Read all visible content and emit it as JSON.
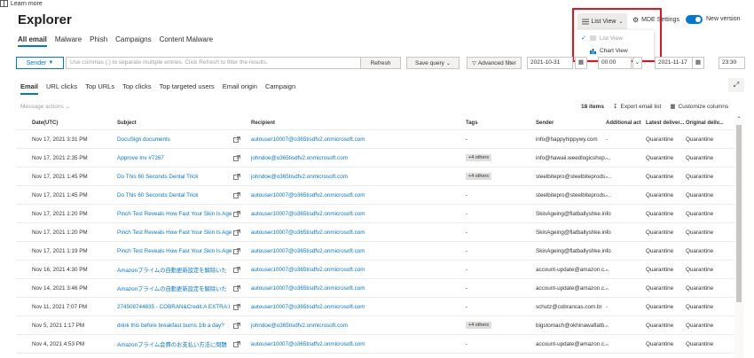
{
  "page": {
    "title": "Explorer"
  },
  "top": {
    "learn_more": "Learn more",
    "list_view": "List View",
    "mde_settings": "MDE Settings",
    "new_version": "New version"
  },
  "dropdown": {
    "list_view": "List View",
    "chart_view": "Chart View"
  },
  "tabs_top": [
    "All email",
    "Malware",
    "Phish",
    "Campaigns",
    "Content Malware"
  ],
  "filter": {
    "sender_label": "Sender",
    "placeholder": "Use commas (,) to separate multiple entries. Click Refresh to filter the results.",
    "refresh": "Refresh",
    "save_query": "Save query",
    "advanced_filter": "Advanced filter",
    "start_date": "2021-10-31",
    "start_time": "00:00",
    "end_date": "2021-11-17",
    "end_time": "23:30"
  },
  "tabs_sub": [
    "Email",
    "URL clicks",
    "Top URLs",
    "Top clicks",
    "Top targeted users",
    "Email origin",
    "Campaign"
  ],
  "message_actions": "Message actions",
  "items_count": "18 items",
  "export": "Export email list",
  "customize": "Customize columns",
  "table": {
    "headers": {
      "date": "Date(UTC)",
      "subject": "Subject",
      "recipient": "Recipient",
      "tags": "Tags",
      "sender": "Sender",
      "additional": "Additional act...",
      "latest": "Latest deliver...",
      "original": "Original deliv..."
    },
    "rows": [
      {
        "date": "Nov 17, 2021 3:31 PM",
        "subject": "DocuSign documents",
        "recipient": "autouser10007@o365tisdfv2.onmicrosoft.com",
        "tags": "-",
        "sender": "info@happyhippywy.com",
        "additional": "-",
        "latest": "Quarantine",
        "original": "Quarantine"
      },
      {
        "date": "Nov 17, 2021 2:35 PM",
        "subject": "Approve Inv #7267",
        "recipient": "johndoe@o365tisdfv2.onmicrosoft.com",
        "tags": "+4 others",
        "sender": "info@hawaii.weedlogicshop....",
        "additional": "-",
        "latest": "Quarantine",
        "original": "Quarantine"
      },
      {
        "date": "Nov 17, 2021 1:45 PM",
        "subject": "Do This 60 Seconds Dental Trick",
        "recipient": "johndoe@o365tisdfv2.onmicrosoft.com",
        "tags": "+4 others",
        "sender": "steelbitepro@steelbiteprods....",
        "additional": "-",
        "latest": "Quarantine",
        "original": "Quarantine"
      },
      {
        "date": "Nov 17, 2021 1:45 PM",
        "subject": "Do This 60 Seconds Dental Trick",
        "recipient": "autouser10007@o365tisdfv2.onmicrosoft.com",
        "tags": "-",
        "sender": "steelbitepro@steelbiteprods....",
        "additional": "-",
        "latest": "Quarantine",
        "original": "Quarantine"
      },
      {
        "date": "Nov 17, 2021 1:20 PM",
        "subject": "Pinch Test Reveals How Fast Your Skin Is Age",
        "recipient": "autouser10007@o365tisdfv2.onmicrosoft.com",
        "tags": "-",
        "sender": "SkinAgeing@flatballyshke.info",
        "additional": "-",
        "latest": "Quarantine",
        "original": "Quarantine"
      },
      {
        "date": "Nov 17, 2021 1:20 PM",
        "subject": "Pinch Test Reveals How Fast Your Skin Is Age",
        "recipient": "autouser10007@o365tisdfv2.onmicrosoft.com",
        "tags": "-",
        "sender": "SkinAgeing@flatballyshke.info",
        "additional": "-",
        "latest": "Quarantine",
        "original": "Quarantine"
      },
      {
        "date": "Nov 17, 2021 1:19 PM",
        "subject": "Pinch Test Reveals How Fast Your Skin Is Age",
        "recipient": "autouser10007@o365tisdfv2.onmicrosoft.com",
        "tags": "-",
        "sender": "SkinAgeing@flatballyshke.info",
        "additional": "-",
        "latest": "Quarantine",
        "original": "Quarantine"
      },
      {
        "date": "Nov 16, 2021 4:30 PM",
        "subject": "Amazonプライムの自動更新設定を解除いた",
        "recipient": "autouser10007@o365tisdfv2.onmicrosoft.com",
        "tags": "-",
        "sender": "account-update@amazon.c...",
        "additional": "-",
        "latest": "Quarantine",
        "original": "Quarantine"
      },
      {
        "date": "Nov 14, 2021 3:46 PM",
        "subject": "Amazonプライムの自動更新設定を解除いた",
        "recipient": "autouser10007@o365tisdfv2.onmicrosoft.com",
        "tags": "-",
        "sender": "account-update@amazon.c...",
        "additional": "-",
        "latest": "Quarantine",
        "original": "Quarantine"
      },
      {
        "date": "Nov 11, 2021 7:07 PM",
        "subject": "274508744835 - COBRAN&Credit:A EXTRA:I",
        "recipient": "autouser10007@o365tisdfv2.onmicrosoft.com",
        "tags": "-",
        "sender": "schutz@cobrancas.com.br",
        "additional": "-",
        "latest": "Quarantine",
        "original": "Quarantine"
      },
      {
        "date": "Nov 5, 2021 1:17 PM",
        "subject": "drink this before breakfast burns 1lb a day?",
        "recipient": "johndoe@o365tisdfv2.onmicrosoft.com",
        "tags": "+4 others",
        "sender": "bigstomach@okhinawaflatb...",
        "additional": "-",
        "latest": "Quarantine",
        "original": "Quarantine"
      },
      {
        "date": "Nov 4, 2021 4:53 PM",
        "subject": "Amazonプライム会費のお支払い方法に問題",
        "recipient": "autouser10007@o365tisdfv2.onmicrosoft.com",
        "tags": "-",
        "sender": "account-update@amazon.c...",
        "additional": "-",
        "latest": "Quarantine",
        "original": "Quarantine"
      }
    ]
  }
}
